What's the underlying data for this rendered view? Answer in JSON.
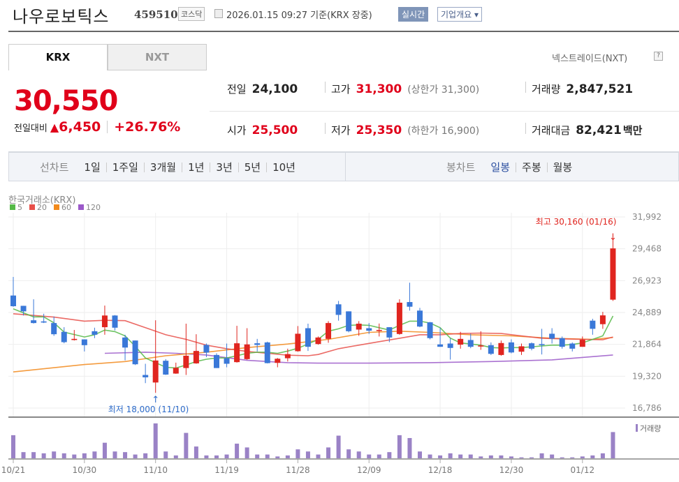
{
  "header": {
    "company_name": "나우로보틱스",
    "code": "459510",
    "market": "코스닥",
    "datetime": "2026.01.15 09:27 기준(KRX 장중)",
    "realtime_badge": "실시간",
    "overview_button": "기업개요 ▾"
  },
  "tabs": [
    {
      "label": "KRX",
      "selected": true
    },
    {
      "label": "NXT",
      "selected": false
    }
  ],
  "nxt_link": "넥스트레이드(NXT)",
  "nxt_help": "?",
  "quote": {
    "price": "30,550",
    "change_label": "전일대비",
    "change_arrow": "▲",
    "change": "6,450",
    "change_pct": "+26.76%"
  },
  "stats": {
    "prev_label": "전일",
    "prev": "24,100",
    "high_label": "고가",
    "high": "31,300",
    "upper_limit": "(상한가 31,300)",
    "volume_label": "거래량",
    "volume": "2,847,521",
    "open_label": "시가",
    "open": "25,500",
    "low_label": "저가",
    "low": "25,350",
    "lower_limit": "(하한가 16,900)",
    "value_label": "거래대금",
    "value": "82,421",
    "value_unit": "백만"
  },
  "period_bar": {
    "line_label": "선차트",
    "line_items": [
      "1일",
      "1주일",
      "3개월",
      "1년",
      "3년",
      "5년",
      "10년"
    ],
    "candle_label": "봉차트",
    "candle_items": [
      "일봉",
      "주봉",
      "월봉"
    ],
    "candle_selected": 0
  },
  "colors": {
    "up": "#e0251f",
    "down": "#3a78d8",
    "ma5": "#55b947",
    "ma20": "#e8504a",
    "ma60": "#f28a1c",
    "ma120": "#9b59c9",
    "volume": "#9a82c6"
  },
  "chart_data": {
    "type": "candlestick",
    "exchange_label": "한국거래소(KRX)",
    "legend": [
      {
        "name": "5",
        "color": "#55b947"
      },
      {
        "name": "20",
        "color": "#e8504a"
      },
      {
        "name": "60",
        "color": "#f28a1c"
      },
      {
        "name": "120",
        "color": "#9b59c9"
      }
    ],
    "ylim": [
      16786,
      31992
    ],
    "y_ticks": [
      "31,992",
      "29,468",
      "26,923",
      "24,889",
      "21,864",
      "19,320",
      "16,786"
    ],
    "x_ticks": [
      {
        "index": 0,
        "label": "10/21"
      },
      {
        "index": 7,
        "label": "10/30"
      },
      {
        "index": 14,
        "label": "11/10"
      },
      {
        "index": 21,
        "label": "11/19"
      },
      {
        "index": 28,
        "label": "11/28"
      },
      {
        "index": 35,
        "label": "12/09"
      },
      {
        "index": 42,
        "label": "12/18"
      },
      {
        "index": 49,
        "label": "12/30"
      },
      {
        "index": 56,
        "label": "01/12"
      }
    ],
    "ohlc": [
      [
        25740,
        27220,
        24850,
        24890
      ],
      [
        24920,
        24920,
        24150,
        24480
      ],
      [
        23770,
        25440,
        23510,
        23550
      ],
      [
        23680,
        24290,
        23550,
        23590
      ],
      [
        23550,
        24070,
        22530,
        22660
      ],
      [
        22850,
        23220,
        21940,
        22030
      ],
      [
        22200,
        23000,
        22160,
        22290
      ],
      [
        22250,
        22250,
        21290,
        21790
      ],
      [
        22900,
        23180,
        22350,
        22620
      ],
      [
        23220,
        24940,
        22620,
        24150
      ],
      [
        24150,
        24180,
        22960,
        23180
      ],
      [
        22400,
        22620,
        20580,
        21600
      ],
      [
        22160,
        22160,
        20210,
        20270
      ],
      [
        19420,
        20310,
        18770,
        19230
      ],
      [
        18820,
        23770,
        18000,
        20570
      ],
      [
        20550,
        20680,
        19420,
        19450
      ],
      [
        19530,
        20400,
        19510,
        19990
      ],
      [
        19970,
        23500,
        19420,
        20950
      ],
      [
        20340,
        22660,
        20310,
        21330
      ],
      [
        21810,
        21920,
        20840,
        21200
      ],
      [
        21010,
        21140,
        19970,
        19970
      ],
      [
        20750,
        21920,
        20030,
        20310
      ],
      [
        20440,
        23330,
        20400,
        21940
      ],
      [
        20680,
        23140,
        20620,
        21850
      ],
      [
        21940,
        22290,
        21290,
        21810
      ],
      [
        22010,
        22070,
        20340,
        20360
      ],
      [
        20380,
        20770,
        20030,
        20710
      ],
      [
        20750,
        21510,
        20490,
        21080
      ],
      [
        21310,
        23310,
        21270,
        22700
      ],
      [
        23140,
        23500,
        21330,
        21660
      ],
      [
        21880,
        22480,
        21830,
        22400
      ],
      [
        22290,
        23700,
        21980,
        23550
      ],
      [
        25040,
        25310,
        23740,
        24200
      ],
      [
        24480,
        24480,
        22810,
        22900
      ],
      [
        23030,
        23700,
        22530,
        23500
      ],
      [
        23140,
        23550,
        22680,
        22940
      ],
      [
        22960,
        23510,
        22480,
        23000
      ],
      [
        23220,
        23220,
        22030,
        22400
      ],
      [
        22680,
        25440,
        22620,
        25170
      ],
      [
        25220,
        26760,
        24540,
        24850
      ],
      [
        24540,
        24760,
        23220,
        23270
      ],
      [
        23610,
        23640,
        22250,
        22350
      ],
      [
        21850,
        23180,
        21660,
        21660
      ],
      [
        21920,
        22350,
        20640,
        21570
      ],
      [
        21830,
        22850,
        21510,
        22290
      ],
      [
        22200,
        22700,
        21550,
        21660
      ],
      [
        21680,
        22900,
        21420,
        21770
      ],
      [
        21790,
        22010,
        21010,
        21100
      ],
      [
        21010,
        22160,
        20950,
        21960
      ],
      [
        22010,
        22250,
        21140,
        21210
      ],
      [
        21270,
        21920,
        21010,
        21700
      ],
      [
        21940,
        22010,
        21380,
        21510
      ],
      [
        21880,
        23090,
        21050,
        21850
      ],
      [
        22700,
        23140,
        21920,
        22310
      ],
      [
        22350,
        22480,
        21510,
        21660
      ],
      [
        21920,
        22010,
        21290,
        21510
      ],
      [
        21660,
        22480,
        21660,
        22220
      ],
      [
        23740,
        23890,
        22620,
        23090
      ],
      [
        23460,
        24440,
        23090,
        24160
      ],
      [
        25410,
        30230,
        25310,
        29490
      ]
    ],
    "volume_thousands": [
      2510,
      670,
      670,
      540,
      740,
      540,
      410,
      540,
      740,
      1690,
      740,
      670,
      410,
      540,
      3790,
      740,
      310,
      2760,
      1280,
      310,
      310,
      410,
      1590,
      1180,
      410,
      410,
      200,
      310,
      970,
      740,
      410,
      1180,
      2460,
      970,
      740,
      410,
      410,
      670,
      2510,
      2200,
      740,
      410,
      310,
      540,
      410,
      410,
      200,
      310,
      310,
      200,
      100,
      100,
      540,
      410,
      100,
      100,
      200,
      310,
      540,
      2850
    ],
    "volume_label": "거래량",
    "ma": {
      "ma5": [
        [
          0,
          24680
        ],
        [
          2,
          24040
        ],
        [
          3,
          24040
        ],
        [
          4,
          23570
        ],
        [
          5,
          22830
        ],
        [
          7,
          22440
        ],
        [
          8,
          22620
        ],
        [
          9,
          22990
        ],
        [
          10,
          22870
        ],
        [
          11,
          22530
        ],
        [
          12,
          21700
        ],
        [
          13,
          20770
        ],
        [
          14,
          20400
        ],
        [
          15,
          20030
        ],
        [
          16,
          19970
        ],
        [
          17,
          20210
        ],
        [
          18,
          20490
        ],
        [
          19,
          20670
        ],
        [
          20,
          20770
        ],
        [
          21,
          20770
        ],
        [
          22,
          20950
        ],
        [
          23,
          21140
        ],
        [
          24,
          21230
        ],
        [
          25,
          21230
        ],
        [
          26,
          21140
        ],
        [
          27,
          21320
        ],
        [
          28,
          21550
        ],
        [
          29,
          21880
        ],
        [
          30,
          22250
        ],
        [
          31,
          22900
        ],
        [
          32,
          23090
        ],
        [
          33,
          23370
        ],
        [
          34,
          23400
        ],
        [
          35,
          23370
        ],
        [
          36,
          23180
        ],
        [
          37,
          22990
        ],
        [
          38,
          23370
        ],
        [
          39,
          23700
        ],
        [
          40,
          23700
        ],
        [
          41,
          23550
        ],
        [
          42,
          23180
        ],
        [
          43,
          22350
        ],
        [
          44,
          21970
        ],
        [
          45,
          21880
        ],
        [
          46,
          21790
        ],
        [
          47,
          21600
        ],
        [
          48,
          21570
        ],
        [
          49,
          21600
        ],
        [
          50,
          21600
        ],
        [
          51,
          21660
        ],
        [
          52,
          21730
        ],
        [
          53,
          21790
        ],
        [
          54,
          21790
        ],
        [
          55,
          21840
        ],
        [
          56,
          21970
        ],
        [
          57,
          22250
        ],
        [
          58,
          22530
        ],
        [
          59,
          24110
        ]
      ],
      "ma20": [
        [
          0,
          24290
        ],
        [
          4,
          24020
        ],
        [
          7,
          23700
        ],
        [
          9,
          23770
        ],
        [
          11,
          23740
        ],
        [
          13,
          23180
        ],
        [
          15,
          22620
        ],
        [
          17,
          22250
        ],
        [
          19,
          21790
        ],
        [
          21,
          21510
        ],
        [
          23,
          21290
        ],
        [
          25,
          21140
        ],
        [
          27,
          20990
        ],
        [
          29,
          20950
        ],
        [
          30,
          21050
        ],
        [
          32,
          21510
        ],
        [
          34,
          21790
        ],
        [
          36,
          22070
        ],
        [
          38,
          22340
        ],
        [
          40,
          22620
        ],
        [
          42,
          22620
        ],
        [
          44,
          22720
        ],
        [
          46,
          22750
        ],
        [
          48,
          22720
        ],
        [
          50,
          22530
        ],
        [
          52,
          22340
        ],
        [
          54,
          22290
        ],
        [
          56,
          22250
        ],
        [
          58,
          22220
        ],
        [
          59,
          22440
        ]
      ],
      "ma60": [
        [
          0,
          19660
        ],
        [
          7,
          20250
        ],
        [
          11,
          20490
        ],
        [
          15,
          20950
        ],
        [
          19,
          21230
        ],
        [
          23,
          21600
        ],
        [
          27,
          21880
        ],
        [
          31,
          22250
        ],
        [
          35,
          22810
        ],
        [
          38,
          22900
        ],
        [
          41,
          22810
        ],
        [
          45,
          22620
        ],
        [
          49,
          22530
        ],
        [
          53,
          22340
        ],
        [
          57,
          22250
        ],
        [
          59,
          22400
        ]
      ],
      "ma120": [
        [
          9,
          21140
        ],
        [
          13,
          21230
        ],
        [
          16,
          21140
        ],
        [
          19,
          21010
        ],
        [
          23,
          20580
        ],
        [
          27,
          20400
        ],
        [
          30,
          20360
        ],
        [
          35,
          20360
        ],
        [
          41,
          20400
        ],
        [
          47,
          20490
        ],
        [
          53,
          20620
        ],
        [
          59,
          21010
        ]
      ]
    },
    "annotations": {
      "high": {
        "label": "최고 30,160 (01/16)",
        "index": 59,
        "value": 30160
      },
      "low": {
        "label": "최저 18,000 (11/10)",
        "index": 14,
        "value": 18000
      }
    }
  }
}
